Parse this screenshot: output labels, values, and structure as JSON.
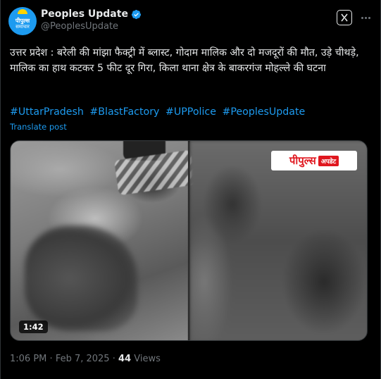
{
  "author": {
    "avatar_line1": "पीपुल्स",
    "avatar_line2": "समाचार",
    "display_name": "Peoples Update",
    "handle": "@PeoplesUpdate",
    "verified": true
  },
  "tweet": {
    "text": "उत्तर प्रदेश : बरेली की मांझा फैक्ट्री में ब्लास्ट, गोदाम मालिक और दो मजदूरों की मौत, उड़े चीथड़े, मालिक का हाथ कटकर 5 फीट दूर गिरा, किला थाना क्षेत्र के बाकरगंज मोहल्ले की घटना",
    "hashtags": [
      "#UttarPradesh",
      "#BlastFactory",
      "#UPPolice",
      "#PeoplesUpdate"
    ],
    "translate_label": "Translate post"
  },
  "media": {
    "watermark_main": "पीपुल्स",
    "watermark_tag": "अपडेट",
    "duration": "1:42"
  },
  "footer": {
    "time": "1:06 PM",
    "separator": "·",
    "date": "Feb 7, 2025",
    "views_count": "44",
    "views_label": "Views"
  },
  "colors": {
    "background": "#000000",
    "text": "#e7e9ea",
    "link": "#1d9bf0",
    "muted": "#71767b",
    "verified": "#1d9bf0",
    "watermark_red": "#e0171f"
  },
  "icons": {
    "verified": "verified-badge-icon",
    "grok": "grok-icon",
    "more": "more-options-icon"
  }
}
